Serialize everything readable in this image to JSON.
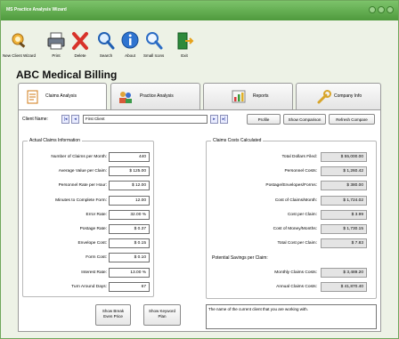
{
  "window": {
    "title": "MS Practice Analysis Wizard"
  },
  "toolbar": {
    "items": [
      {
        "label": "New Client Wizard",
        "icon": "wizard-icon"
      },
      {
        "label": "Print",
        "icon": "printer-icon"
      },
      {
        "label": "Delete",
        "icon": "delete-x-icon"
      },
      {
        "label": "Search",
        "icon": "magnifier-icon"
      },
      {
        "label": "About",
        "icon": "info-icon"
      },
      {
        "label": "Small Icons",
        "icon": "magnifier-small-icon"
      },
      {
        "label": "Exit",
        "icon": "exit-door-icon"
      }
    ]
  },
  "app": {
    "title": "ABC Medical Billing"
  },
  "tabs": [
    {
      "label": "Claims Analysis",
      "icon": "document-icon",
      "active": true
    },
    {
      "label": "Practice Analysis",
      "icon": "people-icon",
      "active": false
    },
    {
      "label": "Reports",
      "icon": "chart-icon",
      "active": false
    },
    {
      "label": "Company Info",
      "icon": "wrench-icon",
      "active": false
    }
  ],
  "client_bar": {
    "label": "Client Name:",
    "value": "First Client",
    "profile_button": "Profile",
    "show_comparison_button": "Show Comparison",
    "refresh_compare_button": "Refresh Compare"
  },
  "actual": {
    "title": "Actual Claims Information",
    "rows": [
      {
        "label": "Number of Claims per Month:",
        "value": "440"
      },
      {
        "label": "Average Value per Claim:",
        "value": "$ 125.00"
      },
      {
        "label": "Personnel Rate per Hour:",
        "value": "$ 12.00"
      },
      {
        "label": "Minutes to Complete Form:",
        "value": "12.00"
      },
      {
        "label": "Error Rate:",
        "value": "32.00 %"
      },
      {
        "label": "Postage Rate:",
        "value": "$ 0.37"
      },
      {
        "label": "Envelope Cost:",
        "value": "$ 0.15"
      },
      {
        "label": "Form Cost:",
        "value": "$ 0.10"
      },
      {
        "label": "Interest Rate:",
        "value": "13.00 %"
      },
      {
        "label": "Turn Around Days:",
        "value": "67"
      }
    ]
  },
  "calculated": {
    "title": "Claims Costs Calculated",
    "rows": [
      {
        "label": "Total Dollars Filed:",
        "value": "$ 55,000.00"
      },
      {
        "label": "Personnel Costs:",
        "value": "$ 1,260.42"
      },
      {
        "label": "Postage/Envelopes/Forms:",
        "value": "$ 380.00"
      },
      {
        "label": "Cost of Claims/Month:",
        "value": "$ 1,724.02"
      },
      {
        "label": "Cost per Claim:",
        "value": "$ 3.99"
      },
      {
        "label": "Cost of Money/Months:",
        "value": "$ 1,730.15"
      },
      {
        "label": "Total Cost per Claim:",
        "value": "$ 7.83"
      }
    ],
    "savings_title": "Potential Savings per Claim:",
    "savings_rows": [
      {
        "label": "Monthly Claims Costs:",
        "value": "$ 3,489.20"
      },
      {
        "label": "Annual Claims Costs:",
        "value": "$ 41,870.40"
      }
    ]
  },
  "bottom": {
    "break_even_button_line1": "Show Break",
    "break_even_button_line2": "Even Price",
    "keyword_plan_button_line1": "Show Keyword",
    "keyword_plan_button_line2": "Plan",
    "help_text": "The name of the current client that you are working with."
  }
}
